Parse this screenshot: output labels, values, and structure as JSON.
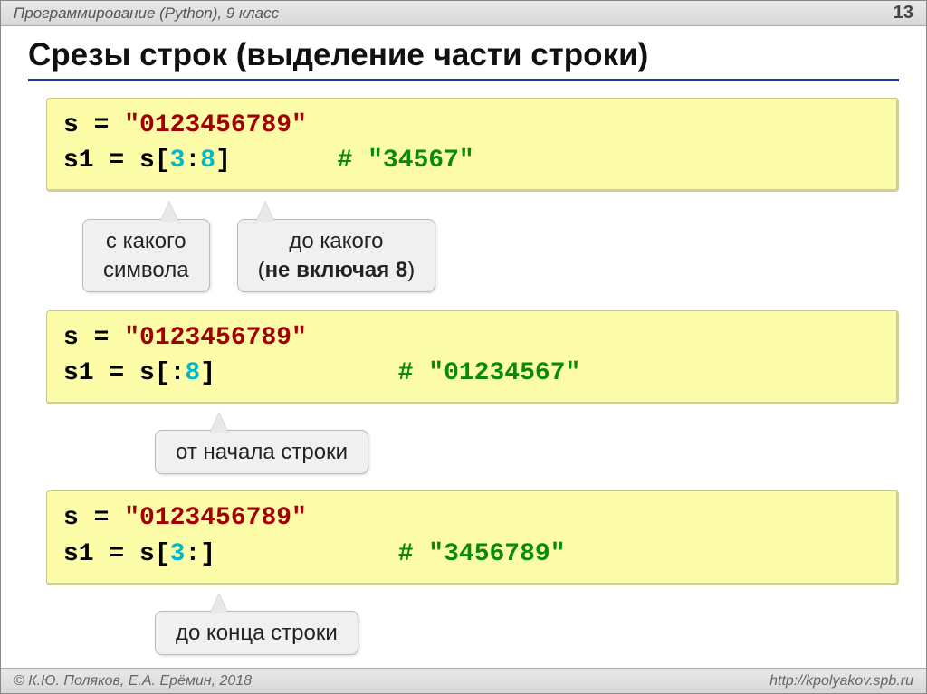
{
  "header": {
    "course": "Программирование (Python), 9 класс",
    "page": "13"
  },
  "title": "Срезы строк (выделение части строки)",
  "block1": {
    "line1_a": "s = ",
    "line1_b": "\"0123456789\"",
    "line2_a": "s1 = s[",
    "line2_n1": "3",
    "line2_mid": ":",
    "line2_n2": "8",
    "line2_b": "]       ",
    "line2_c": "# \"34567\"",
    "callout1_l1": "с какого",
    "callout1_l2": "символа",
    "callout2_l1": "до какого",
    "callout2_l2a": "(",
    "callout2_l2b": "не включая 8",
    "callout2_l2c": ")"
  },
  "block2": {
    "line1_a": "s = ",
    "line1_b": "\"0123456789\"",
    "line2_a": "s1 = s[:",
    "line2_n": "8",
    "line2_b": "]            ",
    "line2_c": "# \"01234567\"",
    "callout": "от начала строки"
  },
  "block3": {
    "line1_a": "s = ",
    "line1_b": "\"0123456789\"",
    "line2_a": "s1 = s[",
    "line2_n": "3",
    "line2_b": ":]            ",
    "line2_c": "# \"3456789\"",
    "callout": "до конца строки"
  },
  "footer": {
    "left": "© К.Ю. Поляков, Е.А. Ерёмин, 2018",
    "right": "http://kpolyakov.spb.ru"
  }
}
